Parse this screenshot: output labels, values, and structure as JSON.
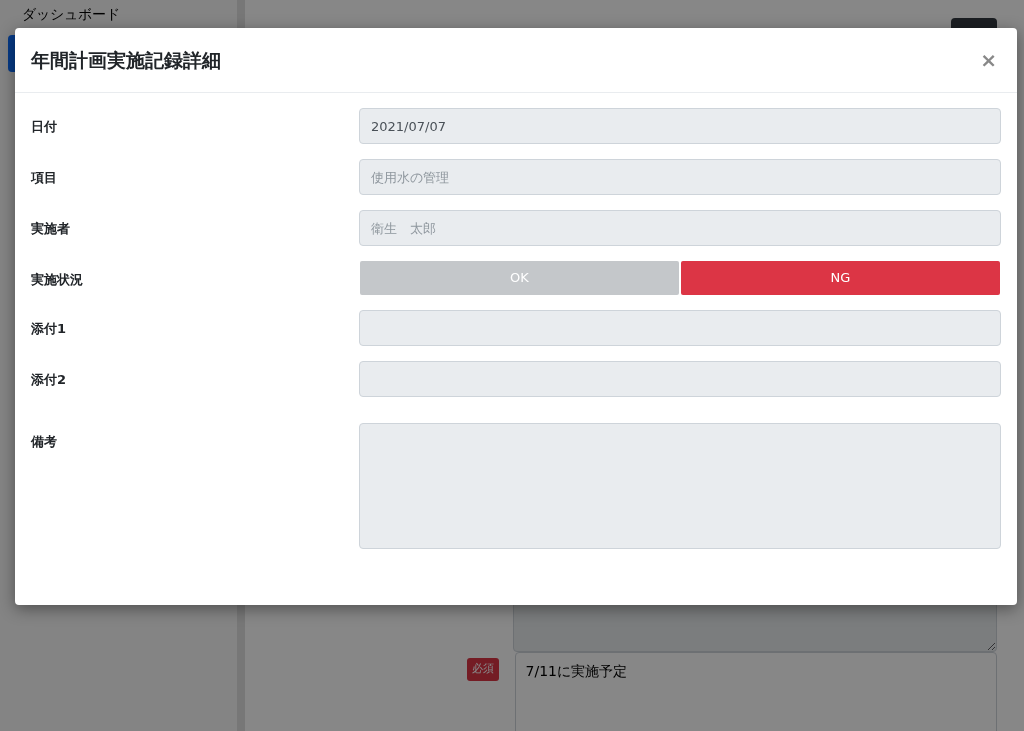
{
  "sidebar": {
    "items": [
      {
        "label": "ダッシュボード",
        "selected": false
      },
      {
        "selected": true
      }
    ]
  },
  "form": {
    "rows": [
      {
        "disabled": true
      },
      {
        "badge": "必須",
        "value": "7/11に実施予定",
        "disabled": false
      }
    ]
  },
  "modal": {
    "title": "年間計画実施記録詳細",
    "close": "×",
    "fields": [
      {
        "label": "日付",
        "kind": "text",
        "value": "2021/07/07"
      },
      {
        "label": "項目",
        "kind": "text",
        "placeholder": "使用水の管理"
      },
      {
        "label": "実施者",
        "kind": "text",
        "placeholder": "衛生　太郎"
      },
      {
        "label": "実施状況",
        "kind": "toggle",
        "options": [
          {
            "label": "OK",
            "selected": false
          },
          {
            "label": "NG",
            "selected": true
          }
        ]
      },
      {
        "label": "添付1",
        "kind": "text"
      },
      {
        "label": "添付2",
        "kind": "text"
      },
      {
        "label": "備考",
        "kind": "textarea"
      }
    ]
  }
}
